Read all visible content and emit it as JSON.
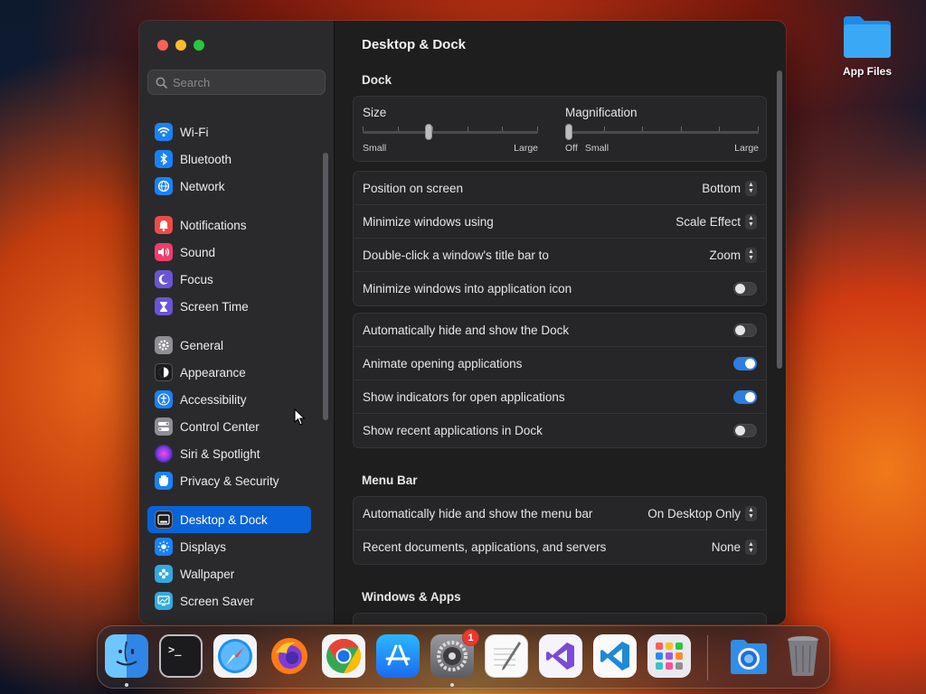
{
  "desktop": {
    "folder_label": "App Files"
  },
  "window": {
    "title": "Desktop & Dock",
    "search_placeholder": "Search",
    "sidebar": {
      "items": [
        {
          "label": "Wi-Fi",
          "icon": "wifi-icon",
          "color": "#1a82f7"
        },
        {
          "label": "Bluetooth",
          "icon": "bluetooth-icon",
          "color": "#1a82f7"
        },
        {
          "label": "Network",
          "icon": "globe-icon",
          "color": "#1a82f7"
        },
        {
          "label": "Notifications",
          "icon": "bell-icon",
          "color": "#ee4a4a"
        },
        {
          "label": "Sound",
          "icon": "speaker-icon",
          "color": "#ee3e6c"
        },
        {
          "label": "Focus",
          "icon": "moon-icon",
          "color": "#6b54d8"
        },
        {
          "label": "Screen Time",
          "icon": "hourglass-icon",
          "color": "#6b54d8"
        },
        {
          "label": "General",
          "icon": "gear-icon",
          "color": "#8e8e93"
        },
        {
          "label": "Appearance",
          "icon": "appearance-icon",
          "color": "#1c1c1e"
        },
        {
          "label": "Accessibility",
          "icon": "accessibility-icon",
          "color": "#1a82f7"
        },
        {
          "label": "Control Center",
          "icon": "toggles-icon",
          "color": "#8e8e93"
        },
        {
          "label": "Siri & Spotlight",
          "icon": "siri-icon",
          "color": "#9b3fd6"
        },
        {
          "label": "Privacy & Security",
          "icon": "hand-icon",
          "color": "#1a82f7"
        },
        {
          "label": "Desktop & Dock",
          "icon": "dock-icon",
          "color": "#1c1c1e"
        },
        {
          "label": "Displays",
          "icon": "sun-icon",
          "color": "#1a82f7"
        },
        {
          "label": "Wallpaper",
          "icon": "flower-icon",
          "color": "#32a9e0"
        },
        {
          "label": "Screen Saver",
          "icon": "screensaver-icon",
          "color": "#32a9e0"
        }
      ],
      "active": "Desktop & Dock"
    },
    "sections": {
      "dock": "Dock",
      "menu_bar": "Menu Bar",
      "windows_apps": "Windows & Apps"
    },
    "size_slider": {
      "label": "Size",
      "min_label": "Small",
      "max_label": "Large",
      "value": 0.37
    },
    "magnification_slider": {
      "label": "Magnification",
      "off_label": "Off",
      "min_label": "Small",
      "max_label": "Large",
      "value": 0.0
    },
    "dock_popups": [
      {
        "label": "Position on screen",
        "value": "Bottom"
      },
      {
        "label": "Minimize windows using",
        "value": "Scale Effect"
      },
      {
        "label": "Double-click a window's title bar to",
        "value": "Zoom"
      }
    ],
    "minimize_into_icon": {
      "label": "Minimize windows into application icon",
      "on": false
    },
    "dock_toggles": [
      {
        "label": "Automatically hide and show the Dock",
        "on": false
      },
      {
        "label": "Animate opening applications",
        "on": true
      },
      {
        "label": "Show indicators for open applications",
        "on": true
      },
      {
        "label": "Show recent applications in Dock",
        "on": false
      }
    ],
    "menu_bar_rows": [
      {
        "label": "Automatically hide and show the menu bar",
        "value": "On Desktop Only"
      },
      {
        "label": "Recent documents, applications, and servers",
        "value": "None"
      }
    ]
  },
  "dock": {
    "apps": [
      {
        "name": "Finder",
        "icon": "finder-icon",
        "running": true
      },
      {
        "name": "Terminal",
        "icon": "terminal-icon",
        "running": false,
        "glyph": ">_"
      },
      {
        "name": "Safari",
        "icon": "safari-icon",
        "running": false
      },
      {
        "name": "Firefox",
        "icon": "firefox-icon",
        "running": false
      },
      {
        "name": "Chrome",
        "icon": "chrome-icon",
        "running": false
      },
      {
        "name": "App Store",
        "icon": "app-store-icon",
        "running": false
      },
      {
        "name": "System Settings",
        "icon": "system-settings-icon",
        "running": true,
        "badge": "1"
      },
      {
        "name": "TextEdit",
        "icon": "textedit-icon",
        "running": false
      },
      {
        "name": "Visual Studio",
        "icon": "visual-studio-icon",
        "running": false
      },
      {
        "name": "VS Code",
        "icon": "vscode-icon",
        "running": false
      },
      {
        "name": "Launchpad",
        "icon": "launchpad-icon",
        "running": false
      }
    ],
    "right_items": [
      {
        "name": "App Files",
        "icon": "folder-stack-icon"
      },
      {
        "name": "Trash",
        "icon": "trash-icon"
      }
    ]
  }
}
